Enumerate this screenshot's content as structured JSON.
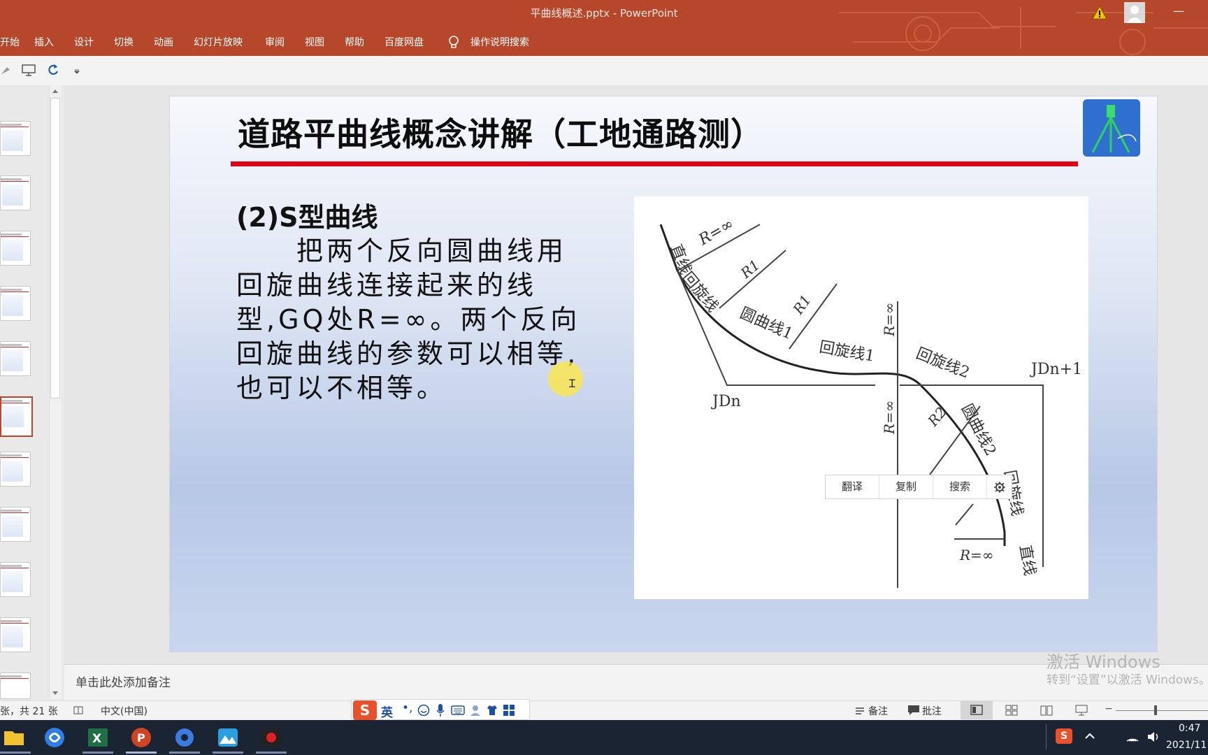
{
  "window": {
    "title": "平曲线概述.pptx  -  PowerPoint"
  },
  "ribbon": {
    "tabs": [
      "开始",
      "插入",
      "设计",
      "切换",
      "动画",
      "幻灯片放映",
      "审阅",
      "视图",
      "帮助",
      "百度网盘"
    ],
    "tell_me": "操作说明搜索"
  },
  "slide": {
    "title": "道路平曲线概念讲解（工地通路测）",
    "heading": "(2)S型曲线",
    "body_lines": [
      "　　把两个反向圆曲线用",
      "回旋曲线连接起来的线",
      "型,GQ处R=∞。两个反向",
      "回旋曲线的参数可以相等,",
      "也可以不相等。"
    ],
    "figure_labels": {
      "straight_top": "直线",
      "r_inf_top": "R=∞",
      "r1_a": "R1",
      "r1_b": "R1",
      "clothoid_top": "回旋线",
      "circle1": "圆曲线1",
      "clothoid1": "回旋线1",
      "r_inf_upper": "R=∞",
      "r_inf_lower": "R=∞",
      "clothoid2": "回旋线2",
      "r2": "R2",
      "circle2": "圆曲线2",
      "clothoid_bottom": "回旋线",
      "jd_n": "JDn",
      "jd_n1": "JDn+1",
      "r_inf_bottom": "R=∞",
      "straight_bottom": "直线"
    }
  },
  "minibar": {
    "translate": "翻译",
    "copy": "复制",
    "search": "搜索"
  },
  "notes": {
    "placeholder": "单击此处添加备注"
  },
  "status": {
    "slide_count": "张，共 21 张",
    "language": "中文(中国)",
    "notes_btn": "备注",
    "comments_btn": "批注",
    "ime_lang": "英"
  },
  "activation": {
    "line1": "激活 Windows",
    "line2": "转到“设置”以激活 Windows。"
  },
  "clock": {
    "time": "0:47",
    "date": "2021/11"
  },
  "colors": {
    "ribbon": "#b7472a",
    "title_rule": "#e00012",
    "taskbar": "#1a2433"
  }
}
